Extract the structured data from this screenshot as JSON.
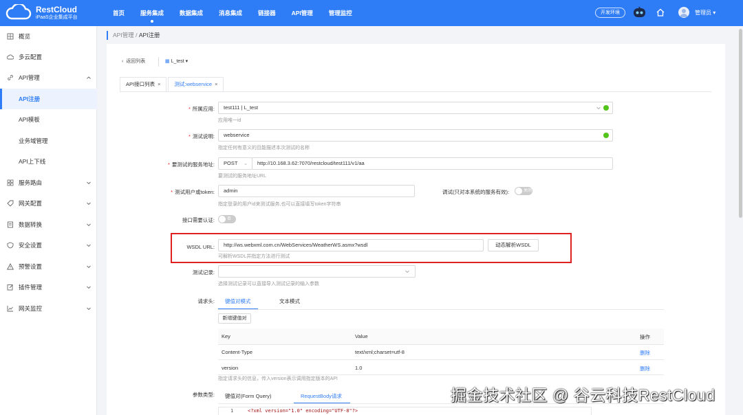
{
  "brand": {
    "title": "RestCloud",
    "subtitle": "iPaaS企业集成平台"
  },
  "nav": [
    "首页",
    "服务集成",
    "数据集成",
    "消息集成",
    "链接器",
    "API管理",
    "管理监控"
  ],
  "header": {
    "env": "开发环境",
    "user": "管理员"
  },
  "sidebar": {
    "items": [
      "概览",
      "多云配置",
      "API管理",
      "API注册",
      "API模板",
      "业务域管理",
      "API上下线",
      "服务路由",
      "网关配置",
      "数据转换",
      "安全设置",
      "预警设置",
      "插件管理",
      "网关监控"
    ]
  },
  "breadcrumb": {
    "parent": "API管理",
    "sep": "/",
    "current": "API注册"
  },
  "toolbar": {
    "back": "返回列表",
    "app": "L_test"
  },
  "tabs": [
    {
      "label": "API接口列表",
      "close": "×"
    },
    {
      "label": "测试:webservice",
      "close": "×"
    }
  ],
  "form": {
    "app": {
      "label": "所属应用:",
      "value": "test111 | L_test",
      "hint": "应用唯一id"
    },
    "desc": {
      "label": "测试说明:",
      "value": "webservice",
      "hint": "指定任何有意义的且能描述本次测试的名称"
    },
    "url": {
      "label": "要测试的服务地址:",
      "method": "POST",
      "value": "http://10.168.3.62:7070/restcloud/test111/v1/aa",
      "hint": "要测试的服务地址URL"
    },
    "token": {
      "label": "测试用户或token:",
      "value": "admin",
      "hint": "指定登录的用户id来测试服务,也可以直接填写token字符串"
    },
    "debug": {
      "label": "调试(只对本系统的服务有效):",
      "state": "关闭"
    },
    "auth": {
      "label": "接口需要认证:",
      "state": "否"
    },
    "wsdl": {
      "label": "WSDL URL:",
      "value": "http://ws.webxml.com.cn/WebServices/WeatherWS.asmx?wsdl",
      "button": "动态解析WSDL",
      "hint": "可解析WSDL并指定方法进行测试"
    },
    "record": {
      "label": "测试记录:",
      "value": "",
      "hint": "选择测试记录可以直接导入测试记录的输入参数"
    },
    "headers": {
      "label": "请求头:",
      "tabs": [
        "键值对模式",
        "文本模式"
      ],
      "add_button": "新增键值对",
      "columns": [
        "Key",
        "Value",
        "操作"
      ],
      "rows": [
        {
          "key": "Content-Type",
          "value": "text/xml;charset=utf-8",
          "action": "删除"
        },
        {
          "key": "version",
          "value": "1.0",
          "action": "删除"
        }
      ],
      "hint": "指定请求头的信息，传入version表示调用指定版本的API"
    },
    "params": {
      "label": "参数类型:",
      "tabs": [
        "键值对(Form Query)",
        "RequestBody请求"
      ],
      "code_line_no": "1",
      "code_line": "<?xml version=\"1.0\" encoding=\"UTF-8\"?>"
    }
  },
  "watermark": "掘金技术社区 @ 谷云科技RestCloud",
  "colors": {
    "primary": "#2f7df6",
    "highlight_box": "#e02020",
    "success": "#52c41a"
  }
}
